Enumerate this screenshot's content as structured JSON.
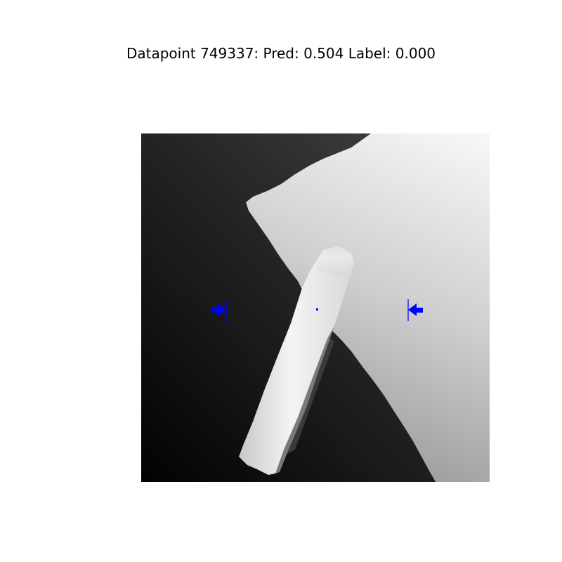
{
  "title": "Datapoint 749337: Pred: 0.504 Label: 0.000",
  "colors": {
    "marker": "#0000ff",
    "background": "#ffffff"
  }
}
